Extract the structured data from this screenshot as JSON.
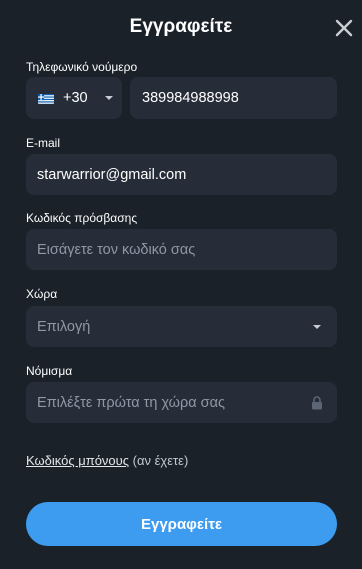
{
  "header": {
    "title": "Εγγραφείτε",
    "close_icon": "close-icon"
  },
  "phone": {
    "label": "Τηλεφωνικό νούμερο",
    "flag_icon": "greek-flag-icon",
    "country_code": "+30",
    "number_value": "389984988998"
  },
  "email": {
    "label": "E-mail",
    "value": "starwarrior@gmail.com"
  },
  "password": {
    "label": "Κωδικός πρόσβασης",
    "placeholder": "Εισάγετε τον κωδικό σας"
  },
  "country": {
    "label": "Χώρα",
    "selected": "Επιλογή"
  },
  "currency": {
    "label": "Νόμισμα",
    "placeholder": "Επιλέξτε πρώτα τη χώρα σας",
    "lock_icon": "lock-icon"
  },
  "bonus": {
    "link": "Κωδικός μπόνους",
    "suffix": " (αν έχετε)"
  },
  "submit": {
    "label": "Εγγραφείτε"
  },
  "colors": {
    "background": "#1b2129",
    "field": "#262d38",
    "accent": "#3d9cf0",
    "placeholder": "#8f98a6"
  }
}
